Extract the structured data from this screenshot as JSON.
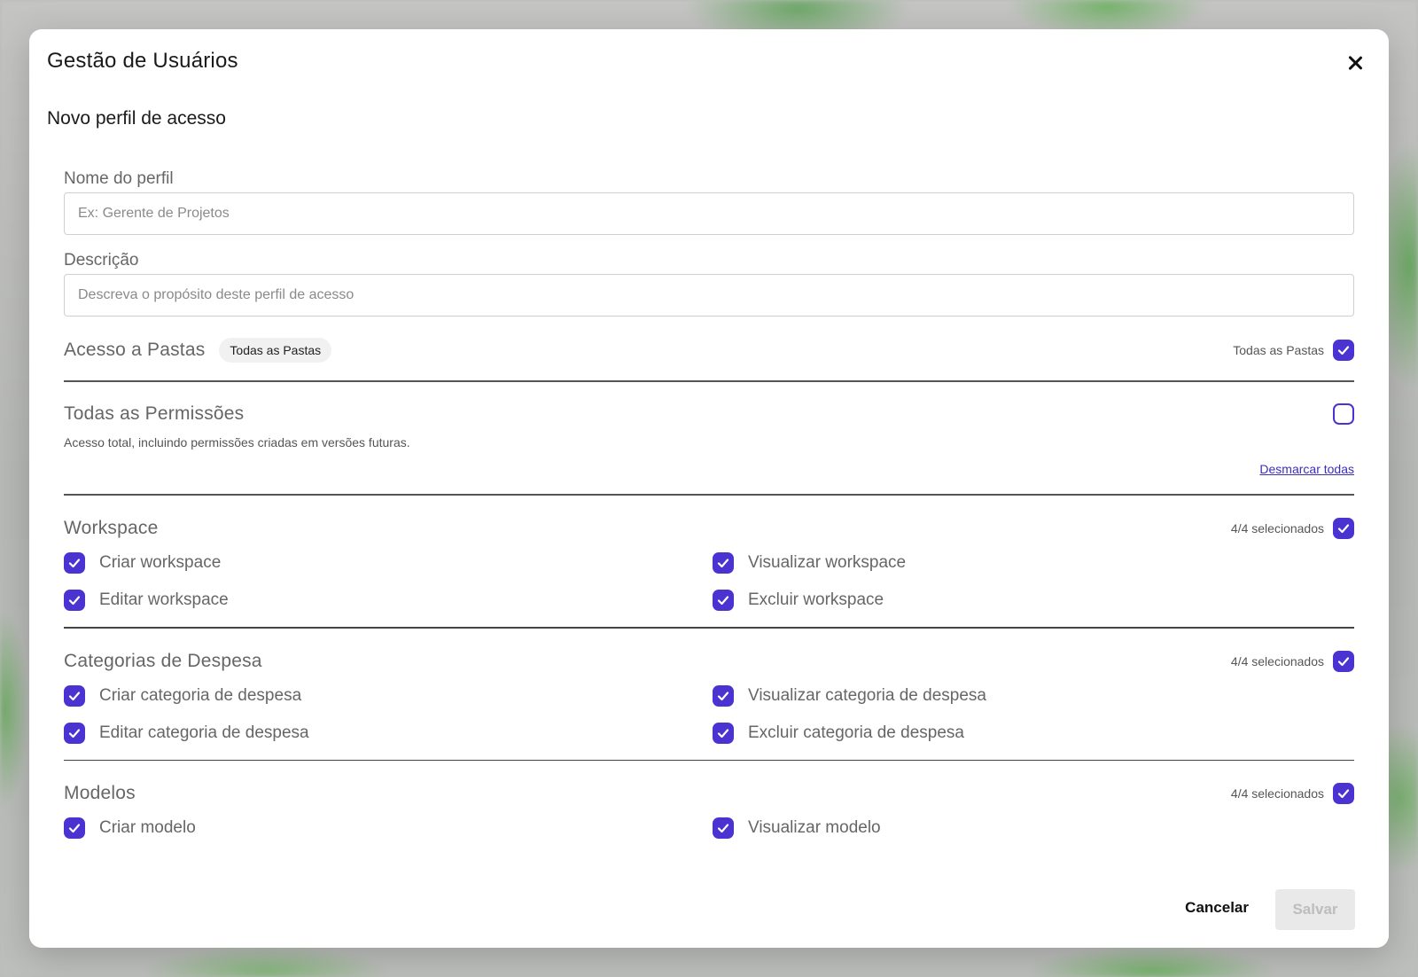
{
  "modal": {
    "title": "Gestão de Usuários",
    "subtitle": "Novo perfil de acesso",
    "accent_color": "#4a33d1"
  },
  "form": {
    "profile_name": {
      "label": "Nome do perfil",
      "placeholder": "Ex: Gerente de Projetos",
      "value": ""
    },
    "description": {
      "label": "Descrição",
      "placeholder": "Descreva o propósito deste perfil de acesso",
      "value": ""
    }
  },
  "folder_access": {
    "title": "Acesso a Pastas",
    "pill": "Todas as Pastas",
    "toggle_label": "Todas as Pastas",
    "checked": true
  },
  "all_permissions": {
    "title": "Todas as Permissões",
    "description": "Acesso total, incluindo permissões criadas em versões futuras.",
    "checked": false,
    "unselect_all": "Desmarcar todas"
  },
  "groups": [
    {
      "title": "Workspace",
      "count": "4/4 selecionados",
      "checked": true,
      "items": [
        {
          "label": "Criar workspace",
          "checked": true
        },
        {
          "label": "Visualizar workspace",
          "checked": true
        },
        {
          "label": "Editar workspace",
          "checked": true
        },
        {
          "label": "Excluir workspace",
          "checked": true
        }
      ]
    },
    {
      "title": "Categorias de Despesa",
      "count": "4/4 selecionados",
      "checked": true,
      "items": [
        {
          "label": "Criar categoria de despesa",
          "checked": true
        },
        {
          "label": "Visualizar categoria de despesa",
          "checked": true
        },
        {
          "label": "Editar categoria de despesa",
          "checked": true
        },
        {
          "label": "Excluir categoria de despesa",
          "checked": true
        }
      ]
    },
    {
      "title": "Modelos",
      "count": "4/4 selecionados",
      "checked": true,
      "items": [
        {
          "label": "Criar modelo",
          "checked": true
        },
        {
          "label": "Visualizar modelo",
          "checked": true
        }
      ]
    }
  ],
  "footer": {
    "cancel_label": "Cancelar",
    "save_label": "Salvar"
  }
}
